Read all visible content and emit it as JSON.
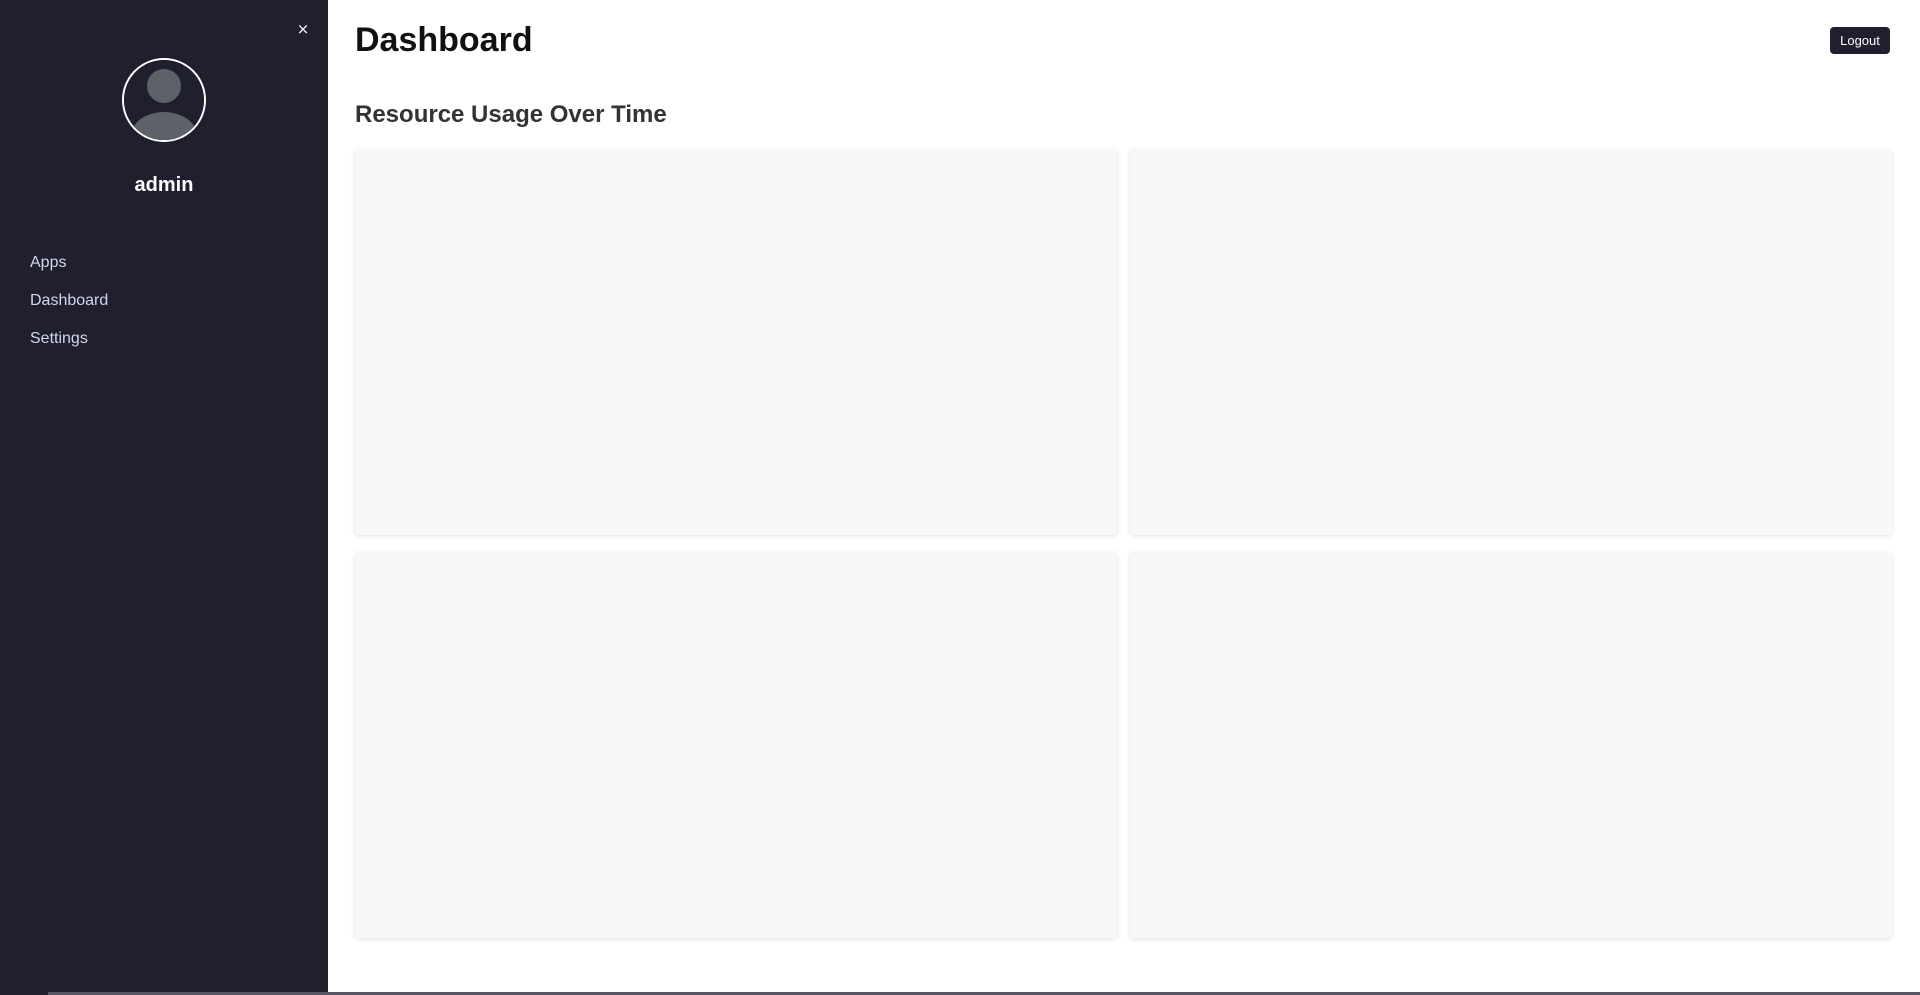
{
  "sidebar": {
    "close_icon": "×",
    "username": "admin",
    "items": [
      {
        "label": "Apps"
      },
      {
        "label": "Dashboard"
      },
      {
        "label": "Settings"
      }
    ]
  },
  "header": {
    "title": "Dashboard",
    "logout_label": "Logout"
  },
  "main": {
    "section_title": "Resource Usage Over Time",
    "charts": [
      {
        "id": 1
      },
      {
        "id": 2
      },
      {
        "id": 3
      },
      {
        "id": 4
      }
    ]
  },
  "colors": {
    "sidebar_bg": "#1f1f2e",
    "nav_text": "#d4d4ee",
    "card_bg": "#f8f8f8",
    "button_bg": "#1f1f2e"
  },
  "icons": {
    "close": "close-icon",
    "avatar": "user-avatar-icon"
  }
}
